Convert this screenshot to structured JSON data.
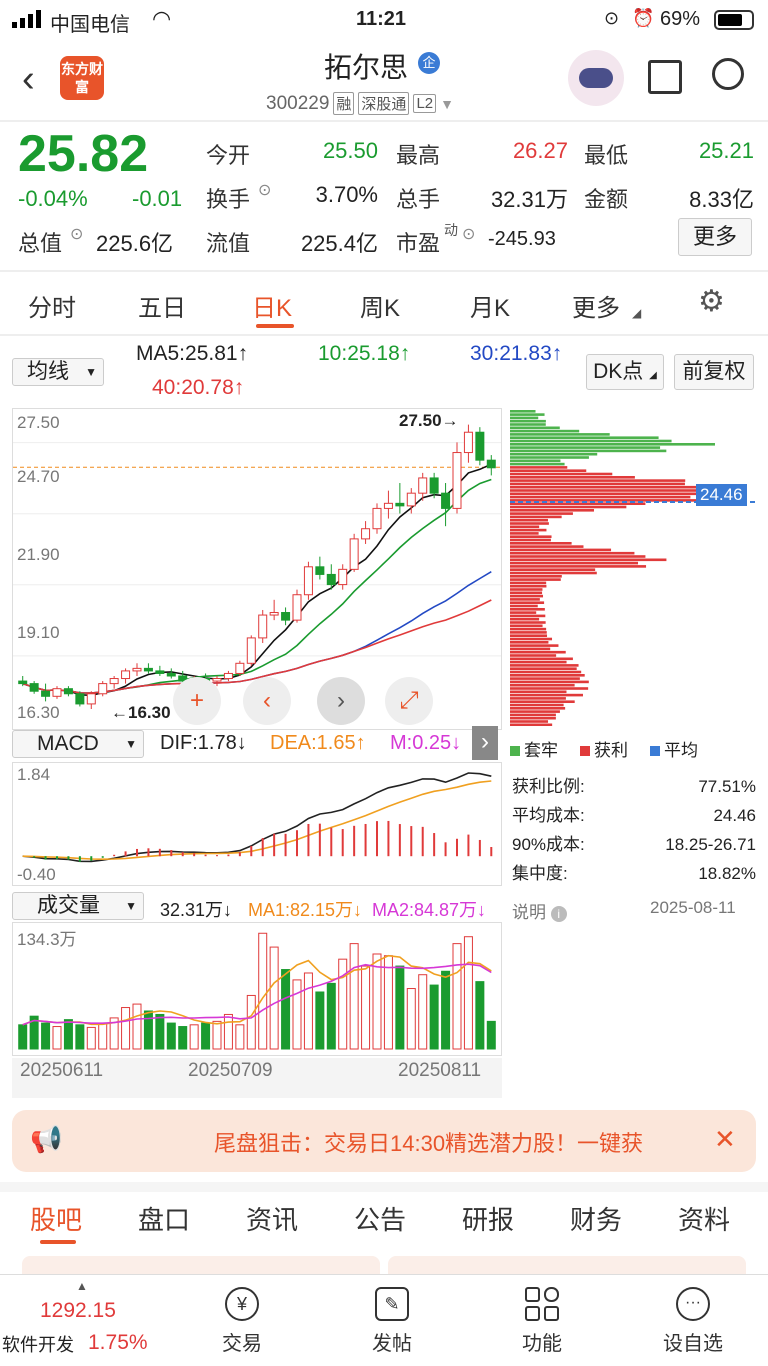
{
  "status": {
    "carrier": "中国电信",
    "time": "11:21",
    "battery": "69%"
  },
  "header": {
    "title": "拓尔思",
    "badge": "企",
    "code": "300229",
    "tags": [
      "融",
      "深股通",
      "L2"
    ],
    "logo_text": "东方财富"
  },
  "quote": {
    "price": "25.82",
    "change_pct": "-0.04%",
    "change": "-0.01",
    "rows": [
      [
        {
          "label": "今开",
          "value": "25.50",
          "color": "g"
        },
        {
          "label": "最高",
          "value": "26.27",
          "color": "r"
        },
        {
          "label": "最低",
          "value": "25.21",
          "color": "g"
        }
      ],
      [
        {
          "label": "换手",
          "value": "3.70%",
          "color": ""
        },
        {
          "label": "总手",
          "value": "32.31万",
          "color": ""
        },
        {
          "label": "金额",
          "value": "8.33亿",
          "color": ""
        }
      ]
    ],
    "total_value_label": "总值",
    "total_value": "225.6亿",
    "float_label": "流值",
    "float_value": "225.4亿",
    "pe_label": "市盈",
    "pe_super": "动",
    "pe_value": "-245.93",
    "more_button": "更多"
  },
  "tabs": [
    "分时",
    "五日",
    "日K",
    "周K",
    "月K",
    "更多"
  ],
  "active_tab": 2,
  "ma": {
    "selector": "均线",
    "ma5": "MA5:25.81↑",
    "ma10": "10:25.18↑",
    "ma30": "30:21.83↑",
    "ma40": "40:20.78↑",
    "dk": "DK点",
    "adjust": "前复权"
  },
  "kchart": {
    "y_labels": [
      "27.50",
      "24.70",
      "21.90",
      "19.10",
      "16.30"
    ],
    "high_label": "27.50→",
    "low_label": "←16.30",
    "price_range": [
      16.3,
      27.8
    ]
  },
  "chip": {
    "avg_label": "24.46",
    "legend": [
      "套牢",
      "获利",
      "平均"
    ],
    "stats": [
      {
        "label": "获利比例:",
        "value": "77.51%"
      },
      {
        "label": "平均成本:",
        "value": "24.46"
      },
      {
        "label": "90%成本:",
        "value": "18.25-26.71"
      },
      {
        "label": "集中度:",
        "value": "18.82%"
      }
    ],
    "note_label": "说明",
    "date": "2025-08-11"
  },
  "macd": {
    "selector": "MACD",
    "dif": "DIF:1.78↓",
    "dea": "DEA:1.65↑",
    "m": "M:0.25↓",
    "top": "1.84",
    "bottom": "-0.40"
  },
  "volume": {
    "selector": "成交量",
    "vol": "32.31万↓",
    "ma1": "MA1:82.15万↓",
    "ma2": "MA2:84.87万↓",
    "top": "134.3万",
    "dates": [
      "20250611",
      "20250709",
      "20250811"
    ]
  },
  "banner": {
    "text": "尾盘狙击：交易日14:30精选潜力股！一键获"
  },
  "subtabs": [
    "股吧",
    "盘口",
    "资讯",
    "公告",
    "研报",
    "财务",
    "资料"
  ],
  "bottom": {
    "index_value": "1292.15",
    "index_name": "软件开发",
    "index_change": "1.75%",
    "items": [
      "交易",
      "发帖",
      "功能",
      "设自选"
    ]
  },
  "colors": {
    "up": "#e03a3a",
    "down": "#1a9b2f",
    "accent": "#e8542a"
  },
  "chart_data": {
    "type": "candlestick",
    "x": [
      "20250611",
      "20250709",
      "20250811"
    ],
    "ylim": [
      16.3,
      27.8
    ],
    "candles": [
      [
        17.4,
        17.6,
        17.2,
        17.3
      ],
      [
        17.3,
        17.4,
        16.9,
        17.0
      ],
      [
        17.0,
        17.3,
        16.6,
        16.8
      ],
      [
        16.8,
        17.2,
        16.7,
        17.1
      ],
      [
        17.1,
        17.2,
        16.8,
        16.9
      ],
      [
        16.9,
        17.0,
        16.4,
        16.5
      ],
      [
        16.5,
        17.0,
        16.3,
        16.9
      ],
      [
        16.9,
        17.4,
        16.8,
        17.3
      ],
      [
        17.3,
        17.6,
        17.1,
        17.5
      ],
      [
        17.5,
        17.9,
        17.3,
        17.8
      ],
      [
        17.8,
        18.1,
        17.6,
        17.9
      ],
      [
        17.9,
        18.1,
        17.7,
        17.8
      ],
      [
        17.8,
        18.0,
        17.6,
        17.7
      ],
      [
        17.7,
        17.9,
        17.5,
        17.6
      ],
      [
        17.6,
        17.8,
        17.3,
        17.4
      ],
      [
        17.4,
        17.6,
        17.2,
        17.5
      ],
      [
        17.5,
        17.7,
        17.3,
        17.4
      ],
      [
        17.4,
        17.6,
        17.2,
        17.5
      ],
      [
        17.5,
        17.8,
        17.4,
        17.7
      ],
      [
        17.7,
        18.2,
        17.6,
        18.1
      ],
      [
        18.1,
        19.2,
        18.0,
        19.1
      ],
      [
        19.1,
        20.2,
        18.9,
        20.0
      ],
      [
        20.0,
        20.6,
        19.8,
        20.1
      ],
      [
        20.1,
        20.3,
        19.6,
        19.8
      ],
      [
        19.8,
        21.0,
        19.7,
        20.8
      ],
      [
        20.8,
        22.1,
        20.6,
        21.9
      ],
      [
        21.9,
        22.3,
        21.4,
        21.6
      ],
      [
        21.6,
        22.0,
        21.0,
        21.2
      ],
      [
        21.2,
        22.0,
        21.0,
        21.8
      ],
      [
        21.8,
        23.2,
        21.7,
        23.0
      ],
      [
        23.0,
        23.7,
        22.8,
        23.4
      ],
      [
        23.4,
        24.4,
        23.2,
        24.2
      ],
      [
        24.2,
        24.9,
        23.8,
        24.4
      ],
      [
        24.4,
        25.2,
        24.0,
        24.3
      ],
      [
        24.3,
        25.0,
        24.0,
        24.8
      ],
      [
        24.8,
        25.6,
        24.5,
        25.4
      ],
      [
        25.4,
        25.6,
        24.6,
        24.8
      ],
      [
        24.8,
        25.2,
        23.5,
        24.2
      ],
      [
        24.2,
        26.8,
        24.0,
        26.4
      ],
      [
        26.4,
        27.5,
        26.0,
        27.2
      ],
      [
        27.2,
        27.4,
        25.9,
        26.1
      ],
      [
        26.1,
        26.3,
        25.5,
        25.8
      ]
    ],
    "volume": [
      28,
      38,
      30,
      26,
      34,
      28,
      25,
      30,
      36,
      48,
      52,
      44,
      40,
      30,
      26,
      28,
      30,
      32,
      40,
      28,
      62,
      134,
      118,
      92,
      80,
      88,
      66,
      76,
      104,
      122,
      96,
      110,
      108,
      96,
      70,
      86,
      74,
      90,
      122,
      130,
      78,
      32
    ]
  }
}
